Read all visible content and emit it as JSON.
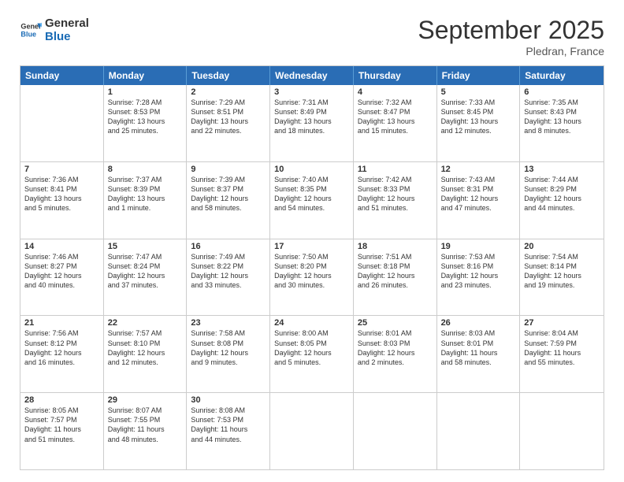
{
  "header": {
    "logo_general": "General",
    "logo_blue": "Blue",
    "month_title": "September 2025",
    "location": "Pledran, France"
  },
  "weekdays": [
    "Sunday",
    "Monday",
    "Tuesday",
    "Wednesday",
    "Thursday",
    "Friday",
    "Saturday"
  ],
  "rows": [
    [
      {
        "day": "",
        "lines": []
      },
      {
        "day": "1",
        "lines": [
          "Sunrise: 7:28 AM",
          "Sunset: 8:53 PM",
          "Daylight: 13 hours",
          "and 25 minutes."
        ]
      },
      {
        "day": "2",
        "lines": [
          "Sunrise: 7:29 AM",
          "Sunset: 8:51 PM",
          "Daylight: 13 hours",
          "and 22 minutes."
        ]
      },
      {
        "day": "3",
        "lines": [
          "Sunrise: 7:31 AM",
          "Sunset: 8:49 PM",
          "Daylight: 13 hours",
          "and 18 minutes."
        ]
      },
      {
        "day": "4",
        "lines": [
          "Sunrise: 7:32 AM",
          "Sunset: 8:47 PM",
          "Daylight: 13 hours",
          "and 15 minutes."
        ]
      },
      {
        "day": "5",
        "lines": [
          "Sunrise: 7:33 AM",
          "Sunset: 8:45 PM",
          "Daylight: 13 hours",
          "and 12 minutes."
        ]
      },
      {
        "day": "6",
        "lines": [
          "Sunrise: 7:35 AM",
          "Sunset: 8:43 PM",
          "Daylight: 13 hours",
          "and 8 minutes."
        ]
      }
    ],
    [
      {
        "day": "7",
        "lines": [
          "Sunrise: 7:36 AM",
          "Sunset: 8:41 PM",
          "Daylight: 13 hours",
          "and 5 minutes."
        ]
      },
      {
        "day": "8",
        "lines": [
          "Sunrise: 7:37 AM",
          "Sunset: 8:39 PM",
          "Daylight: 13 hours",
          "and 1 minute."
        ]
      },
      {
        "day": "9",
        "lines": [
          "Sunrise: 7:39 AM",
          "Sunset: 8:37 PM",
          "Daylight: 12 hours",
          "and 58 minutes."
        ]
      },
      {
        "day": "10",
        "lines": [
          "Sunrise: 7:40 AM",
          "Sunset: 8:35 PM",
          "Daylight: 12 hours",
          "and 54 minutes."
        ]
      },
      {
        "day": "11",
        "lines": [
          "Sunrise: 7:42 AM",
          "Sunset: 8:33 PM",
          "Daylight: 12 hours",
          "and 51 minutes."
        ]
      },
      {
        "day": "12",
        "lines": [
          "Sunrise: 7:43 AM",
          "Sunset: 8:31 PM",
          "Daylight: 12 hours",
          "and 47 minutes."
        ]
      },
      {
        "day": "13",
        "lines": [
          "Sunrise: 7:44 AM",
          "Sunset: 8:29 PM",
          "Daylight: 12 hours",
          "and 44 minutes."
        ]
      }
    ],
    [
      {
        "day": "14",
        "lines": [
          "Sunrise: 7:46 AM",
          "Sunset: 8:27 PM",
          "Daylight: 12 hours",
          "and 40 minutes."
        ]
      },
      {
        "day": "15",
        "lines": [
          "Sunrise: 7:47 AM",
          "Sunset: 8:24 PM",
          "Daylight: 12 hours",
          "and 37 minutes."
        ]
      },
      {
        "day": "16",
        "lines": [
          "Sunrise: 7:49 AM",
          "Sunset: 8:22 PM",
          "Daylight: 12 hours",
          "and 33 minutes."
        ]
      },
      {
        "day": "17",
        "lines": [
          "Sunrise: 7:50 AM",
          "Sunset: 8:20 PM",
          "Daylight: 12 hours",
          "and 30 minutes."
        ]
      },
      {
        "day": "18",
        "lines": [
          "Sunrise: 7:51 AM",
          "Sunset: 8:18 PM",
          "Daylight: 12 hours",
          "and 26 minutes."
        ]
      },
      {
        "day": "19",
        "lines": [
          "Sunrise: 7:53 AM",
          "Sunset: 8:16 PM",
          "Daylight: 12 hours",
          "and 23 minutes."
        ]
      },
      {
        "day": "20",
        "lines": [
          "Sunrise: 7:54 AM",
          "Sunset: 8:14 PM",
          "Daylight: 12 hours",
          "and 19 minutes."
        ]
      }
    ],
    [
      {
        "day": "21",
        "lines": [
          "Sunrise: 7:56 AM",
          "Sunset: 8:12 PM",
          "Daylight: 12 hours",
          "and 16 minutes."
        ]
      },
      {
        "day": "22",
        "lines": [
          "Sunrise: 7:57 AM",
          "Sunset: 8:10 PM",
          "Daylight: 12 hours",
          "and 12 minutes."
        ]
      },
      {
        "day": "23",
        "lines": [
          "Sunrise: 7:58 AM",
          "Sunset: 8:08 PM",
          "Daylight: 12 hours",
          "and 9 minutes."
        ]
      },
      {
        "day": "24",
        "lines": [
          "Sunrise: 8:00 AM",
          "Sunset: 8:05 PM",
          "Daylight: 12 hours",
          "and 5 minutes."
        ]
      },
      {
        "day": "25",
        "lines": [
          "Sunrise: 8:01 AM",
          "Sunset: 8:03 PM",
          "Daylight: 12 hours",
          "and 2 minutes."
        ]
      },
      {
        "day": "26",
        "lines": [
          "Sunrise: 8:03 AM",
          "Sunset: 8:01 PM",
          "Daylight: 11 hours",
          "and 58 minutes."
        ]
      },
      {
        "day": "27",
        "lines": [
          "Sunrise: 8:04 AM",
          "Sunset: 7:59 PM",
          "Daylight: 11 hours",
          "and 55 minutes."
        ]
      }
    ],
    [
      {
        "day": "28",
        "lines": [
          "Sunrise: 8:05 AM",
          "Sunset: 7:57 PM",
          "Daylight: 11 hours",
          "and 51 minutes."
        ]
      },
      {
        "day": "29",
        "lines": [
          "Sunrise: 8:07 AM",
          "Sunset: 7:55 PM",
          "Daylight: 11 hours",
          "and 48 minutes."
        ]
      },
      {
        "day": "30",
        "lines": [
          "Sunrise: 8:08 AM",
          "Sunset: 7:53 PM",
          "Daylight: 11 hours",
          "and 44 minutes."
        ]
      },
      {
        "day": "",
        "lines": []
      },
      {
        "day": "",
        "lines": []
      },
      {
        "day": "",
        "lines": []
      },
      {
        "day": "",
        "lines": []
      }
    ]
  ]
}
